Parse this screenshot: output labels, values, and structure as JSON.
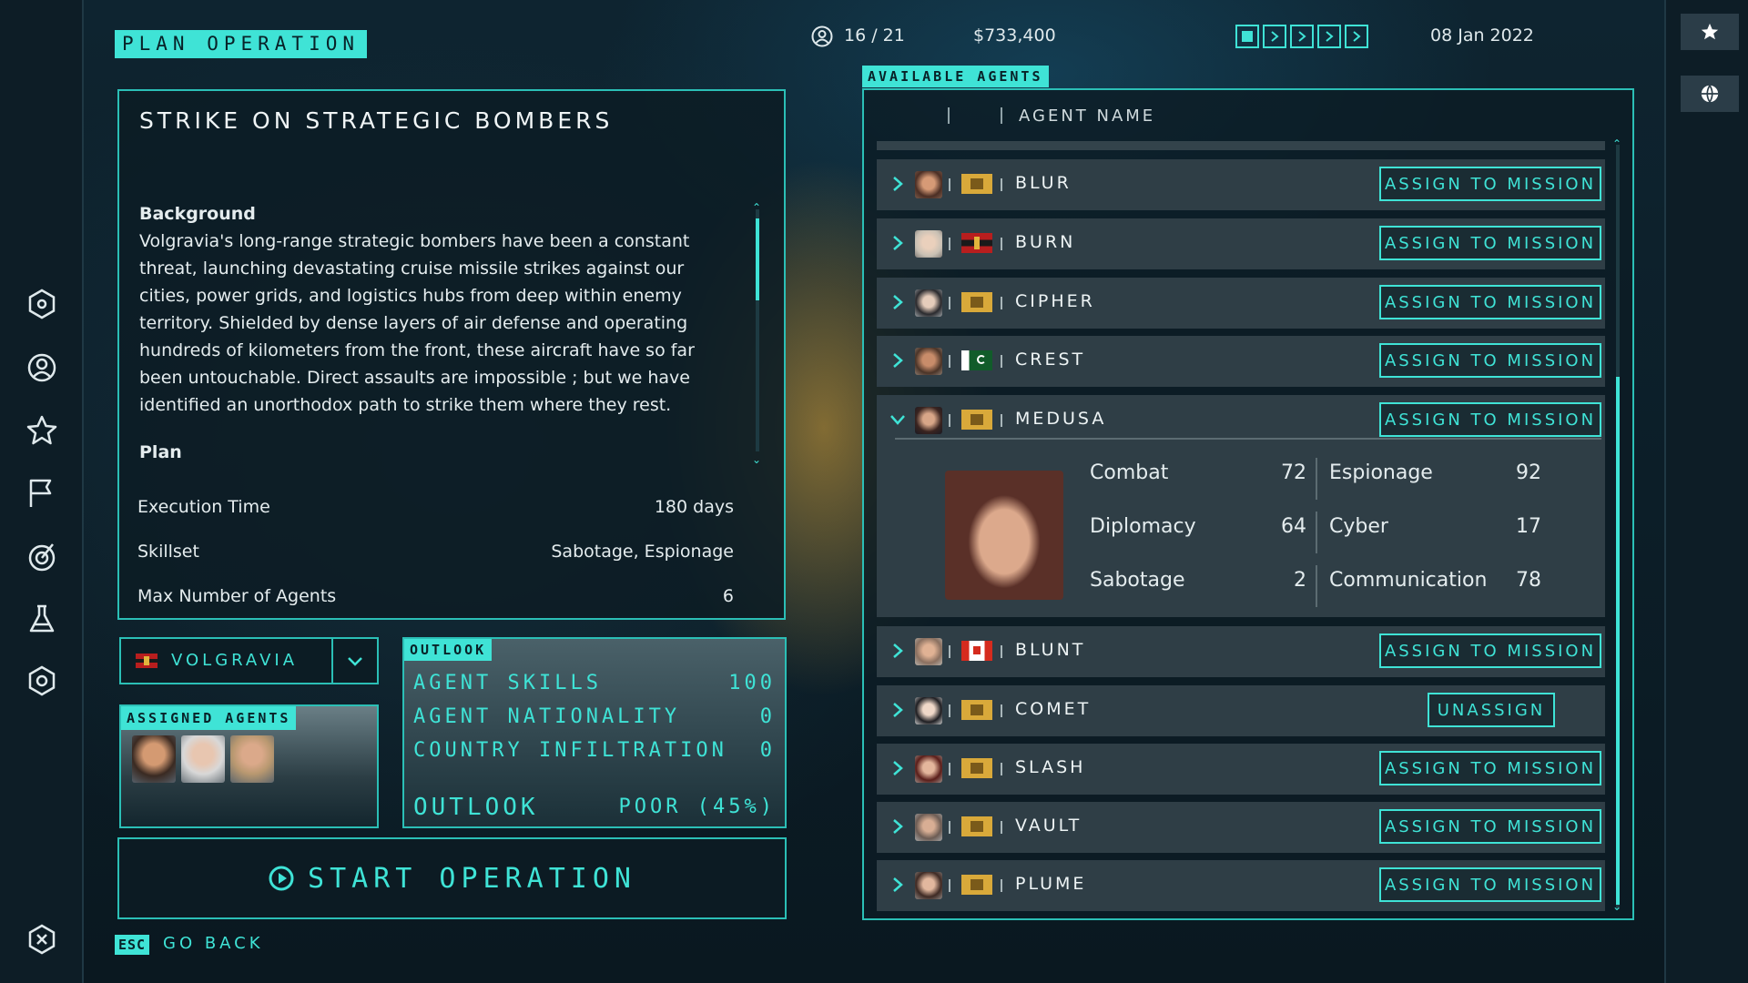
{
  "header": {
    "plan_title": "PLAN OPERATION",
    "agents_count": "16 / 21",
    "funds": "$733,400",
    "date": "08 Jan 2022"
  },
  "mission": {
    "title": "STRIKE ON STRATEGIC BOMBERS",
    "background_heading": "Background",
    "background_text": "Volgravia's long-range strategic bombers have been a constant threat, launching devastating cruise missile strikes against our cities, power grids, and logistics hubs from deep within enemy territory. Shielded by dense layers of air defense and operating hundreds of kilometers from the front, these aircraft have so far been untouchable. Direct assaults are impossible ; but we have identified an unorthodox path to strike them where they rest.",
    "plan_heading": "Plan",
    "info": [
      {
        "label": "Execution Time",
        "value": "180 days"
      },
      {
        "label": "Skillset",
        "value": "Sabotage, Espionage"
      },
      {
        "label": "Max Number of Agents",
        "value": "6"
      }
    ]
  },
  "country": {
    "name": "VOLGRAVIA"
  },
  "assigned": {
    "title": "ASSIGNED AGENTS"
  },
  "outlook": {
    "tag": "OUTLOOK",
    "rows": [
      {
        "label": "AGENT SKILLS",
        "value": "100"
      },
      {
        "label": "AGENT NATIONALITY",
        "value": "0"
      },
      {
        "label": "COUNTRY INFILTRATION",
        "value": "0"
      }
    ],
    "summary_label": "OUTLOOK",
    "summary_value": "POOR (45%)"
  },
  "actions": {
    "start": "START OPERATION",
    "esc_key": "ESC",
    "go_back": "GO BACK"
  },
  "agents_panel": {
    "title": "AVAILABLE AGENTS",
    "column_name": "AGENT NAME",
    "assign_label": "ASSIGN TO MISSION",
    "unassign_label": "UNASSIGN",
    "agents": [
      {
        "name": "BLUR",
        "action": "assign"
      },
      {
        "name": "BURN",
        "action": "assign"
      },
      {
        "name": "CIPHER",
        "action": "assign"
      },
      {
        "name": "CREST",
        "action": "assign"
      },
      {
        "name": "MEDUSA",
        "action": "assign",
        "expanded": true
      },
      {
        "name": "BLUNT",
        "action": "assign"
      },
      {
        "name": "COMET",
        "action": "unassign"
      },
      {
        "name": "SLASH",
        "action": "assign"
      },
      {
        "name": "VAULT",
        "action": "assign"
      },
      {
        "name": "PLUME",
        "action": "assign"
      }
    ],
    "medusa_stats": [
      {
        "label": "Combat",
        "value": "72"
      },
      {
        "label": "Espionage",
        "value": "92"
      },
      {
        "label": "Diplomacy",
        "value": "64"
      },
      {
        "label": "Cyber",
        "value": "17"
      },
      {
        "label": "Sabotage",
        "value": "2"
      },
      {
        "label": "Communication",
        "value": "78"
      }
    ]
  },
  "colors": {
    "accent": "#3fe3d6",
    "panel": "#2f3e46",
    "background": "#0b1a22"
  }
}
